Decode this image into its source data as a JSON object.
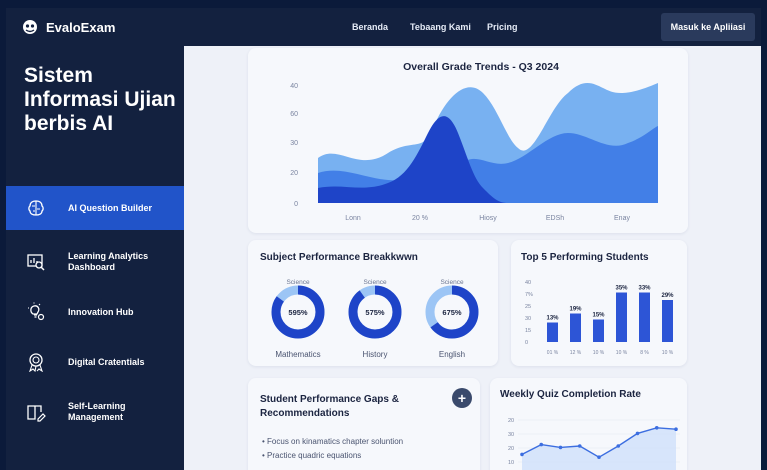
{
  "app": {
    "name": "EvaloExam"
  },
  "nav": {
    "links": [
      "Beranda",
      "Tebaang Kami",
      "Pricing"
    ],
    "cta": "Masuk ke Apliiasi"
  },
  "sidebar": {
    "title": "Sistem Informasi Ujian berbis AI",
    "items": [
      {
        "label": "AI Question Builder",
        "icon": "brain-icon",
        "active": true
      },
      {
        "label": "Learning Analytics Dashboard",
        "icon": "analytics-search-icon",
        "active": false
      },
      {
        "label": "Innovation Hub",
        "icon": "lightbulb-gear-icon",
        "active": false
      },
      {
        "label": "Digital Cratentials",
        "icon": "badge-award-icon",
        "active": false
      },
      {
        "label": "Self-Learning Management",
        "icon": "book-pen-icon",
        "active": false
      }
    ]
  },
  "colors": {
    "accent": "#2154c9",
    "navy": "#13213f",
    "light_blue": "#6aa9f0",
    "bg": "#eef1f8"
  },
  "grade_trends": {
    "title": "Overall Grade Trends - Q3 2024",
    "chart_data": {
      "type": "area",
      "title": "Overall Grade Trends - Q3 2024",
      "y_ticks": [
        0,
        20,
        30,
        60,
        40
      ],
      "x_ticks": [
        "Lonn",
        "20 %",
        "Hiosy",
        "EDSh",
        "Enay"
      ]
    }
  },
  "subject": {
    "title": "Subject Performance Breakkwwn",
    "chart_data": {
      "type": "pie",
      "items": [
        {
          "top_label": "Science",
          "center": "595%",
          "name": "Mathematics",
          "fraction": 0.85
        },
        {
          "top_label": "Science",
          "center": "575%",
          "name": "History",
          "fraction": 0.9
        },
        {
          "top_label": "Science",
          "center": "675%",
          "name": "English",
          "fraction": 0.65
        }
      ]
    }
  },
  "top5": {
    "title": "Top 5 Performing Students",
    "chart_data": {
      "type": "bar",
      "y_ticks": [
        "40",
        "7%",
        "25",
        "30",
        "15",
        "0"
      ],
      "categories": [
        "01 %",
        "12 %",
        "10 %",
        "10 %",
        "8 %",
        "10 %"
      ],
      "values": [
        13,
        19,
        15,
        33,
        33,
        28
      ],
      "labels": [
        "13%",
        "19%",
        "15%",
        "35%",
        "33%",
        "29%"
      ],
      "ylim": [
        0,
        40
      ]
    }
  },
  "gaps": {
    "title": "Student Performance Gaps & Recommendations",
    "plus_label": "+",
    "bullets": [
      "Focus on kinamatics chapter soluntion",
      "Practice quadric equations"
    ]
  },
  "weekly": {
    "title": "Weekly Quiz Completion Rate",
    "chart_data": {
      "type": "line",
      "y_ticks": [
        "20",
        "30",
        "20",
        "10"
      ],
      "values": [
        14,
        21,
        19,
        20,
        12,
        20,
        29,
        33,
        32
      ],
      "ylim": [
        0,
        40
      ]
    }
  }
}
